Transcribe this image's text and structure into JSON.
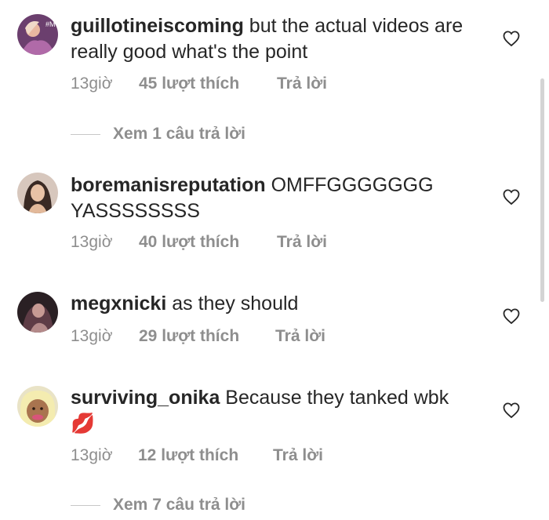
{
  "comments": [
    {
      "username": "guillotineiscoming",
      "text": " but the actual videos are really good what's the point",
      "time": "13giờ",
      "likes": "45 lượt thích",
      "reply": "Trả lời",
      "view_replies": "Xem 1 câu trả lời"
    },
    {
      "username": "boremanisreputation",
      "text": " OMFFGGGGGGG YASSSSSSSS",
      "time": "13giờ",
      "likes": "40 lượt thích",
      "reply": "Trả lời"
    },
    {
      "username": "megxnicki",
      "text": " as they should",
      "time": "13giờ",
      "likes": "29 lượt thích",
      "reply": "Trả lời"
    },
    {
      "username": "surviving_onika",
      "text": " Because they tanked wbk ",
      "emoji": "💋",
      "time": "13giờ",
      "likes": "12 lượt thích",
      "reply": "Trả lời",
      "view_replies": "Xem 7 câu trả lời"
    }
  ],
  "icons": {
    "like": "heart-outline-icon",
    "kiss": "kiss-mark-emoji"
  },
  "colors": {
    "text": "#262626",
    "meta": "#8e8e8e",
    "kiss": "#e0245e"
  }
}
